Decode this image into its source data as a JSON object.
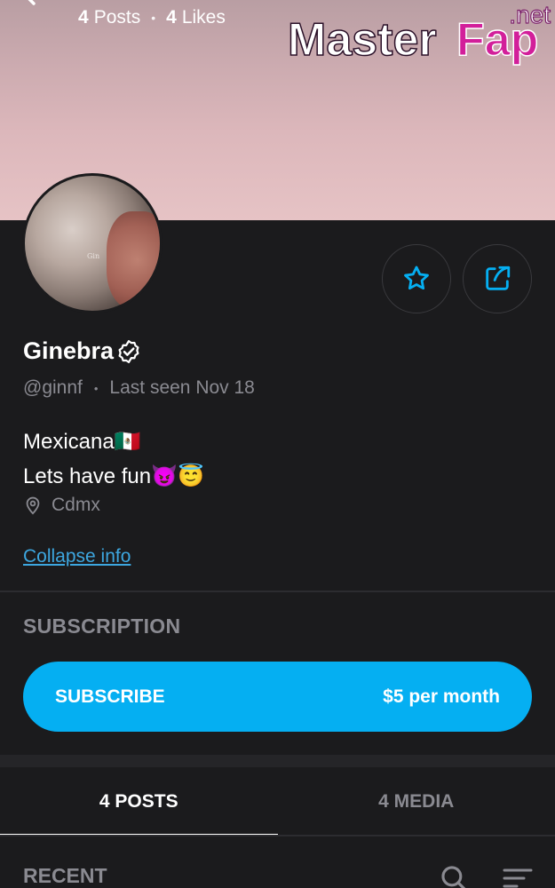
{
  "header": {
    "posts_count": "4",
    "posts_label": "Posts",
    "likes_count": "4",
    "likes_label": "Likes",
    "separator": "•"
  },
  "watermark": {
    "brand_part1": "Master",
    "brand_part2": "Fap",
    "brand_suffix": ".net"
  },
  "avatar": {
    "tag_text": "Gin"
  },
  "profile": {
    "name": "Ginebra",
    "handle": "@ginnf",
    "separator": "•",
    "last_seen": "Last seen Nov 18",
    "bio_line1": "Mexicana🇲🇽",
    "bio_line2": "Lets have fun😈😇",
    "location": "Cdmx",
    "collapse_link": "Collapse info"
  },
  "subscription": {
    "section_title": "SUBSCRIPTION",
    "button_label": "SUBSCRIBE",
    "price": "$5 per month"
  },
  "tabs": [
    {
      "label": "4 POSTS",
      "active": true
    },
    {
      "label": "4 MEDIA",
      "active": false
    }
  ],
  "feed": {
    "section_title": "RECENT"
  },
  "colors": {
    "accent": "#05aff2",
    "background": "#1b1b1d",
    "muted_text": "#8a8a91",
    "link": "#3da7e0"
  },
  "icons": {
    "back": "arrow-left-icon",
    "favorite": "star-icon",
    "share": "share-icon",
    "verified": "verified-badge-icon",
    "location": "map-pin-icon",
    "search": "search-icon",
    "sort": "sort-icon"
  }
}
